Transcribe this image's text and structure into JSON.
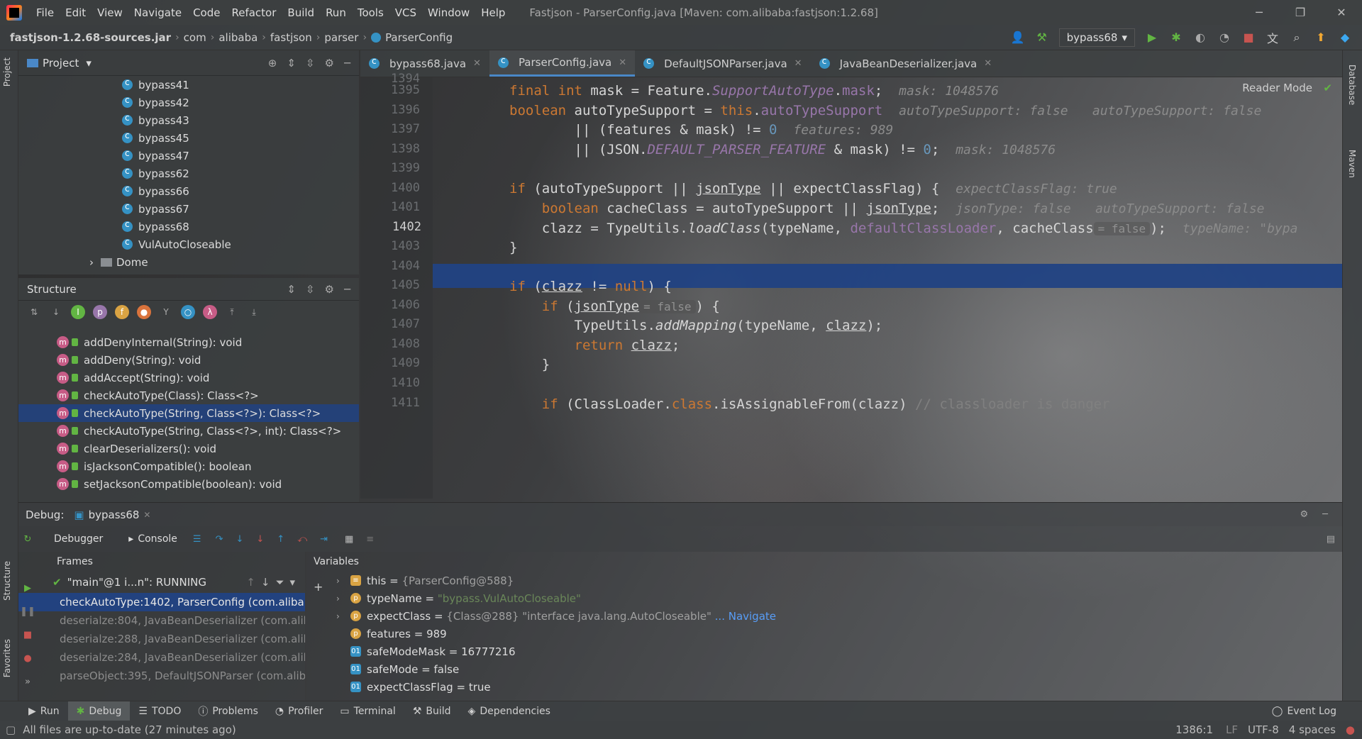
{
  "menu": {
    "items": [
      "File",
      "Edit",
      "View",
      "Navigate",
      "Code",
      "Refactor",
      "Build",
      "Run",
      "Tools",
      "VCS",
      "Window",
      "Help"
    ],
    "title": "Fastjson - ParserConfig.java [Maven: com.alibaba:fastjson:1.2.68]"
  },
  "navbar": {
    "crumbs": [
      "fastjson-1.2.68-sources.jar",
      "com",
      "alibaba",
      "fastjson",
      "parser",
      "ParserConfig"
    ],
    "run_config": "bypass68"
  },
  "sidebar": {
    "left_tabs": [
      "Project",
      "Structure",
      "Favorites"
    ],
    "right_tabs": [
      "Database",
      "Maven"
    ]
  },
  "project": {
    "title": "Project",
    "items": [
      "bypass41",
      "bypass42",
      "bypass43",
      "bypass45",
      "bypass47",
      "bypass62",
      "bypass66",
      "bypass67",
      "bypass68",
      "VulAutoCloseable",
      "Dome"
    ]
  },
  "structure": {
    "title": "Structure",
    "items": [
      "addDenyInternal(String): void",
      "addDeny(String): void",
      "addAccept(String): void",
      "checkAutoType(Class): Class<?>",
      "checkAutoType(String, Class<?>): Class<?>",
      "checkAutoType(String, Class<?>, int): Class<?>",
      "clearDeserializers(): void",
      "isJacksonCompatible(): boolean",
      "setJacksonCompatible(boolean): void"
    ],
    "selected_index": 4
  },
  "editor": {
    "tabs": [
      "bypass68.java",
      "ParserConfig.java",
      "DefaultJSONParser.java",
      "JavaBeanDeserializer.java"
    ],
    "active_tab": 1,
    "reader_mode": "Reader Mode",
    "line_numbers": [
      "1394",
      "1395",
      "1396",
      "1397",
      "1398",
      "1399",
      "1400",
      "1401",
      "1402",
      "1403",
      "1404",
      "1405",
      "1406",
      "1407",
      "1408",
      "1409",
      "1410",
      "1411"
    ],
    "current_line": "1402",
    "hints": {
      "mask": "mask: 1048576",
      "autotype": "autoTypeSupport: false",
      "features": "features: 989",
      "expect": "expectClassFlag: true",
      "jsontype": "jsonType: false",
      "typename": "typeName: \"bypa",
      "inlay_false": "= false"
    }
  },
  "debug": {
    "label": "Debug:",
    "session": "bypass68",
    "tabs": [
      "Debugger",
      "Console"
    ],
    "frames_title": "Frames",
    "thread": "\"main\"@1 i...n\": RUNNING",
    "frames": [
      "checkAutoType:1402, ParserConfig (com.alibab",
      "deserialze:804, JavaBeanDeserializer (com.aliba",
      "deserialze:288, JavaBeanDeserializer (com.aliba",
      "deserialze:284, JavaBeanDeserializer (com.aliba",
      "parseObject:395, DefaultJSONParser (com.aliba"
    ],
    "variables_title": "Variables",
    "variables": [
      {
        "name": "this",
        "value": "{ParserConfig@588}"
      },
      {
        "name": "typeName",
        "value": "\"bypass.VulAutoCloseable\""
      },
      {
        "name": "expectClass",
        "value": "{Class@288} \"interface java.lang.AutoCloseable\"",
        "link": "... Navigate"
      },
      {
        "name": "features",
        "value": "989"
      },
      {
        "name": "safeModeMask",
        "value": "16777216"
      },
      {
        "name": "safeMode",
        "value": "false"
      },
      {
        "name": "expectClassFlag",
        "value": "true"
      }
    ]
  },
  "bottom": {
    "tools": [
      "Run",
      "Debug",
      "TODO",
      "Problems",
      "Profiler",
      "Terminal",
      "Build",
      "Dependencies"
    ],
    "event_log": "Event Log"
  },
  "status": {
    "message": "All files are up-to-date (27 minutes ago)",
    "position": "1386:1",
    "line_sep": "LF",
    "encoding": "UTF-8",
    "indent": "4 spaces"
  },
  "colors": {
    "accent": "#214283",
    "keyword": "#cc7832",
    "field": "#9876aa",
    "string": "#6a8759"
  }
}
